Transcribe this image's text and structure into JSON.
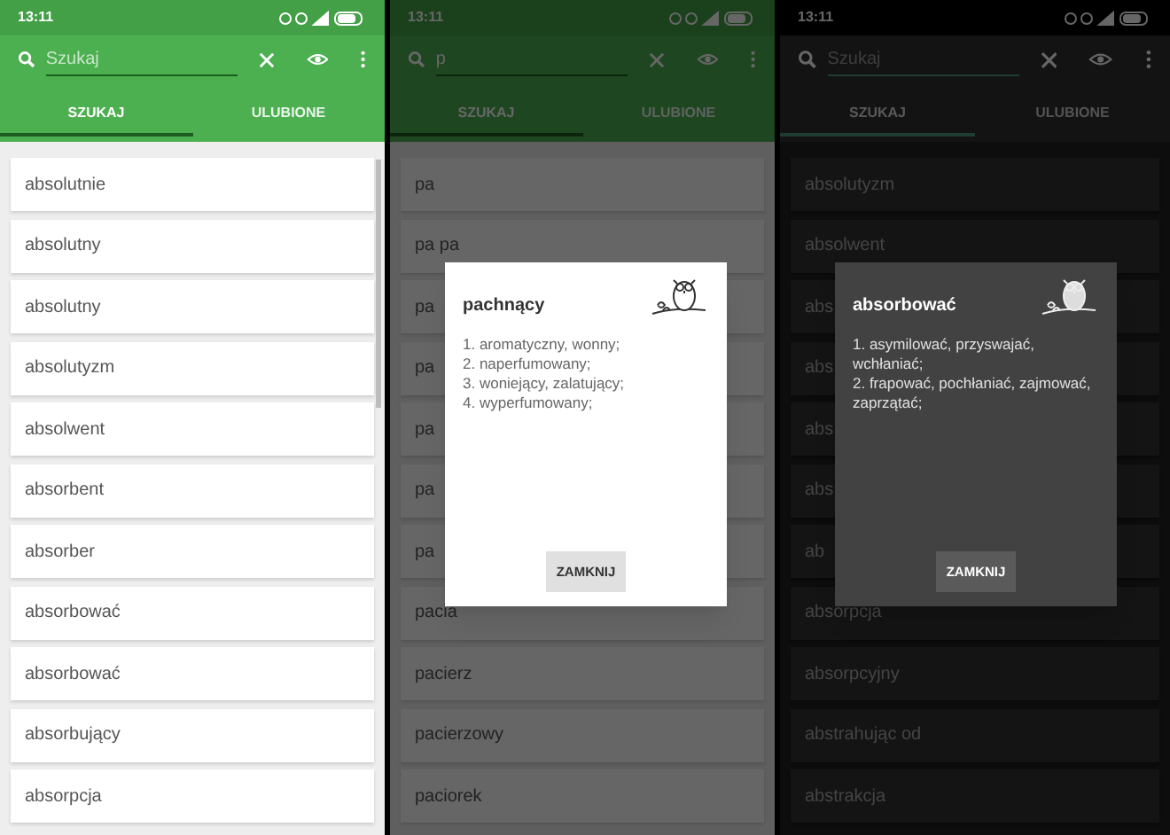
{
  "screens": [
    {
      "kind": "light",
      "status_bar": {
        "time": "13:11"
      },
      "search": {
        "placeholder": "Szukaj"
      },
      "tabs": [
        {
          "label": "SZUKAJ",
          "selected": true
        },
        {
          "label": "ULUBIONE",
          "selected": false
        }
      ],
      "items": [
        "absolutnie",
        "absolutny",
        "absolutny",
        "absolutyzm",
        "absolwent",
        "absorbent",
        "absorber",
        "absorbować",
        "absorbować",
        "absorbujący",
        "absorpcja"
      ]
    },
    {
      "kind": "light",
      "status_bar": {
        "time": "13:11"
      },
      "search": {
        "value": "p"
      },
      "tabs": [
        {
          "label": "SZUKAJ",
          "selected": true
        },
        {
          "label": "ULUBIONE",
          "selected": false
        }
      ],
      "items": [
        "pa",
        "pa pa",
        "pa",
        "pa",
        "pa",
        "pa",
        "pa",
        "pacia",
        "pacierz",
        "pacierzowy",
        "paciorek"
      ],
      "dialog": {
        "title": "pachnący",
        "definitions": [
          "1. aromatyczny, wonny;",
          "2. naperfumowany;",
          "3. woniejący, zalatujący;",
          "4. wyperfumowany;"
        ],
        "button": "ZAMKNIJ"
      }
    },
    {
      "kind": "dark",
      "status_bar": {
        "time": "13:11"
      },
      "search": {
        "placeholder": "Szukaj"
      },
      "tabs": [
        {
          "label": "SZUKAJ",
          "selected": true
        },
        {
          "label": "ULUBIONE",
          "selected": false
        }
      ],
      "items": [
        "absolutyzm",
        "absolwent",
        "abs",
        "abs",
        "abs",
        "abs",
        "ab",
        "absorpcja",
        "absorpcyjny",
        "abstrahując od",
        "abstrakcja"
      ],
      "dialog": {
        "title": "absorbować",
        "definitions": [
          "1. asymilować, przyswajać, wchłaniać;",
          "2. frapować, pochłaniać, zajmować, zaprzątać;"
        ],
        "button": "ZAMKNIJ"
      }
    }
  ]
}
